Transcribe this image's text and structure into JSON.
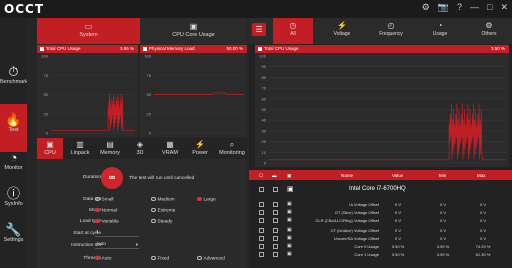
{
  "app": {
    "logo": "OCCT"
  },
  "window_controls": [
    "⚙",
    "📷",
    "?",
    "—",
    "□",
    "✕"
  ],
  "sidebar": {
    "items": [
      {
        "label": "Benchmark",
        "icon": "stopwatch-icon",
        "glyph": "⏱"
      },
      {
        "label": "Test",
        "icon": "flame-icon",
        "glyph": "🔥"
      },
      {
        "label": "Monitor",
        "icon": "gauge-icon",
        "glyph": "◔"
      },
      {
        "label": "SysInfo",
        "icon": "info-icon",
        "glyph": "ⓘ"
      },
      {
        "label": "Settings",
        "icon": "wrench-icon",
        "glyph": "🔧"
      }
    ]
  },
  "left": {
    "tabs": [
      {
        "label": "System",
        "icon": "monitor-icon",
        "glyph": "▭"
      },
      {
        "label": "CPU Core Usage",
        "icon": "cpu-icon",
        "glyph": "▣"
      }
    ],
    "chart1": {
      "title": "Total CPU Usage",
      "value": "3.95 %",
      "yticks": [
        "100",
        "75",
        "50",
        "25",
        "0"
      ]
    },
    "chart2": {
      "title": "Physical Memory Load",
      "value": "50.00 %",
      "yticks": [
        "100",
        "75",
        "50",
        "25",
        "0"
      ]
    },
    "subtabs": [
      {
        "label": "CPU",
        "glyph": "▣"
      },
      {
        "label": "Linpack",
        "glyph": "▥"
      },
      {
        "label": "Memory",
        "glyph": "▤"
      },
      {
        "label": "3D",
        "glyph": "◈"
      },
      {
        "label": "VRAM",
        "glyph": "▦"
      },
      {
        "label": "Power",
        "glyph": "⚡"
      },
      {
        "label": "Monitoring",
        "glyph": "⌕"
      }
    ],
    "settings": {
      "duration_label": "Duration",
      "duration_text": "The test will run until cancelled",
      "dataset_label": "Data set",
      "dataset_options": [
        "Small",
        "Medium",
        "Large"
      ],
      "mode_label": "Mode",
      "mode_options": [
        "Normal",
        "Extreme"
      ],
      "loadtype_label": "Load type",
      "loadtype_options": [
        "Variable",
        "Steady"
      ],
      "startcycle_label": "Start at cycle",
      "startcycle_value": "1",
      "instruction_label": "Instruction set",
      "instruction_value": "Auto",
      "threads_label": "Threads",
      "threads_options": [
        "Auto",
        "Fixed",
        "Advanced"
      ]
    }
  },
  "right": {
    "tabs": [
      {
        "label": "All",
        "glyph": "◷"
      },
      {
        "label": "Voltage",
        "glyph": "⚡"
      },
      {
        "label": "Frequency",
        "glyph": "◴"
      },
      {
        "label": "Usage",
        "glyph": "◔"
      },
      {
        "label": "Others",
        "glyph": "⚙"
      }
    ],
    "chart": {
      "title": "Total CPU Usage",
      "value": "3.50 %",
      "yticks": [
        "100",
        "90",
        "80",
        "70",
        "60",
        "50",
        "40",
        "30",
        "20",
        "10",
        "0"
      ]
    },
    "table": {
      "headers": [
        "Name",
        "Value",
        "Min",
        "Max"
      ],
      "cpu_name": "Intel Core i7-6700HQ",
      "rows": [
        {
          "name": "IA Voltage Offset",
          "value": "0 V",
          "min": "0 V",
          "max": "0 V"
        },
        {
          "name": "GT (Slice) Voltage Offset",
          "value": "0 V",
          "min": "0 V",
          "max": "0 V"
        },
        {
          "name": "CLR (CBo/LLC/Ring) Voltage Offset",
          "value": "0 V",
          "min": "0 V",
          "max": "0 V"
        },
        {
          "name": "GT (Unslice) Voltage Offset",
          "value": "0 V",
          "min": "0 V",
          "max": "0 V"
        },
        {
          "name": "Uncore/SA Voltage Offset",
          "value": "0 V",
          "min": "0 V",
          "max": "0 V"
        },
        {
          "name": "Core 0 Usage",
          "value": "3.90 %",
          "min": "3.90 %",
          "max": "74.20 %"
        },
        {
          "name": "Core 1 Usage",
          "value": "3.90 %",
          "min": "3.90 %",
          "max": "61.30 %"
        }
      ]
    }
  },
  "colors": {
    "accent": "#c21f25",
    "panel": "#262626",
    "bg": "#1c1c1c"
  }
}
